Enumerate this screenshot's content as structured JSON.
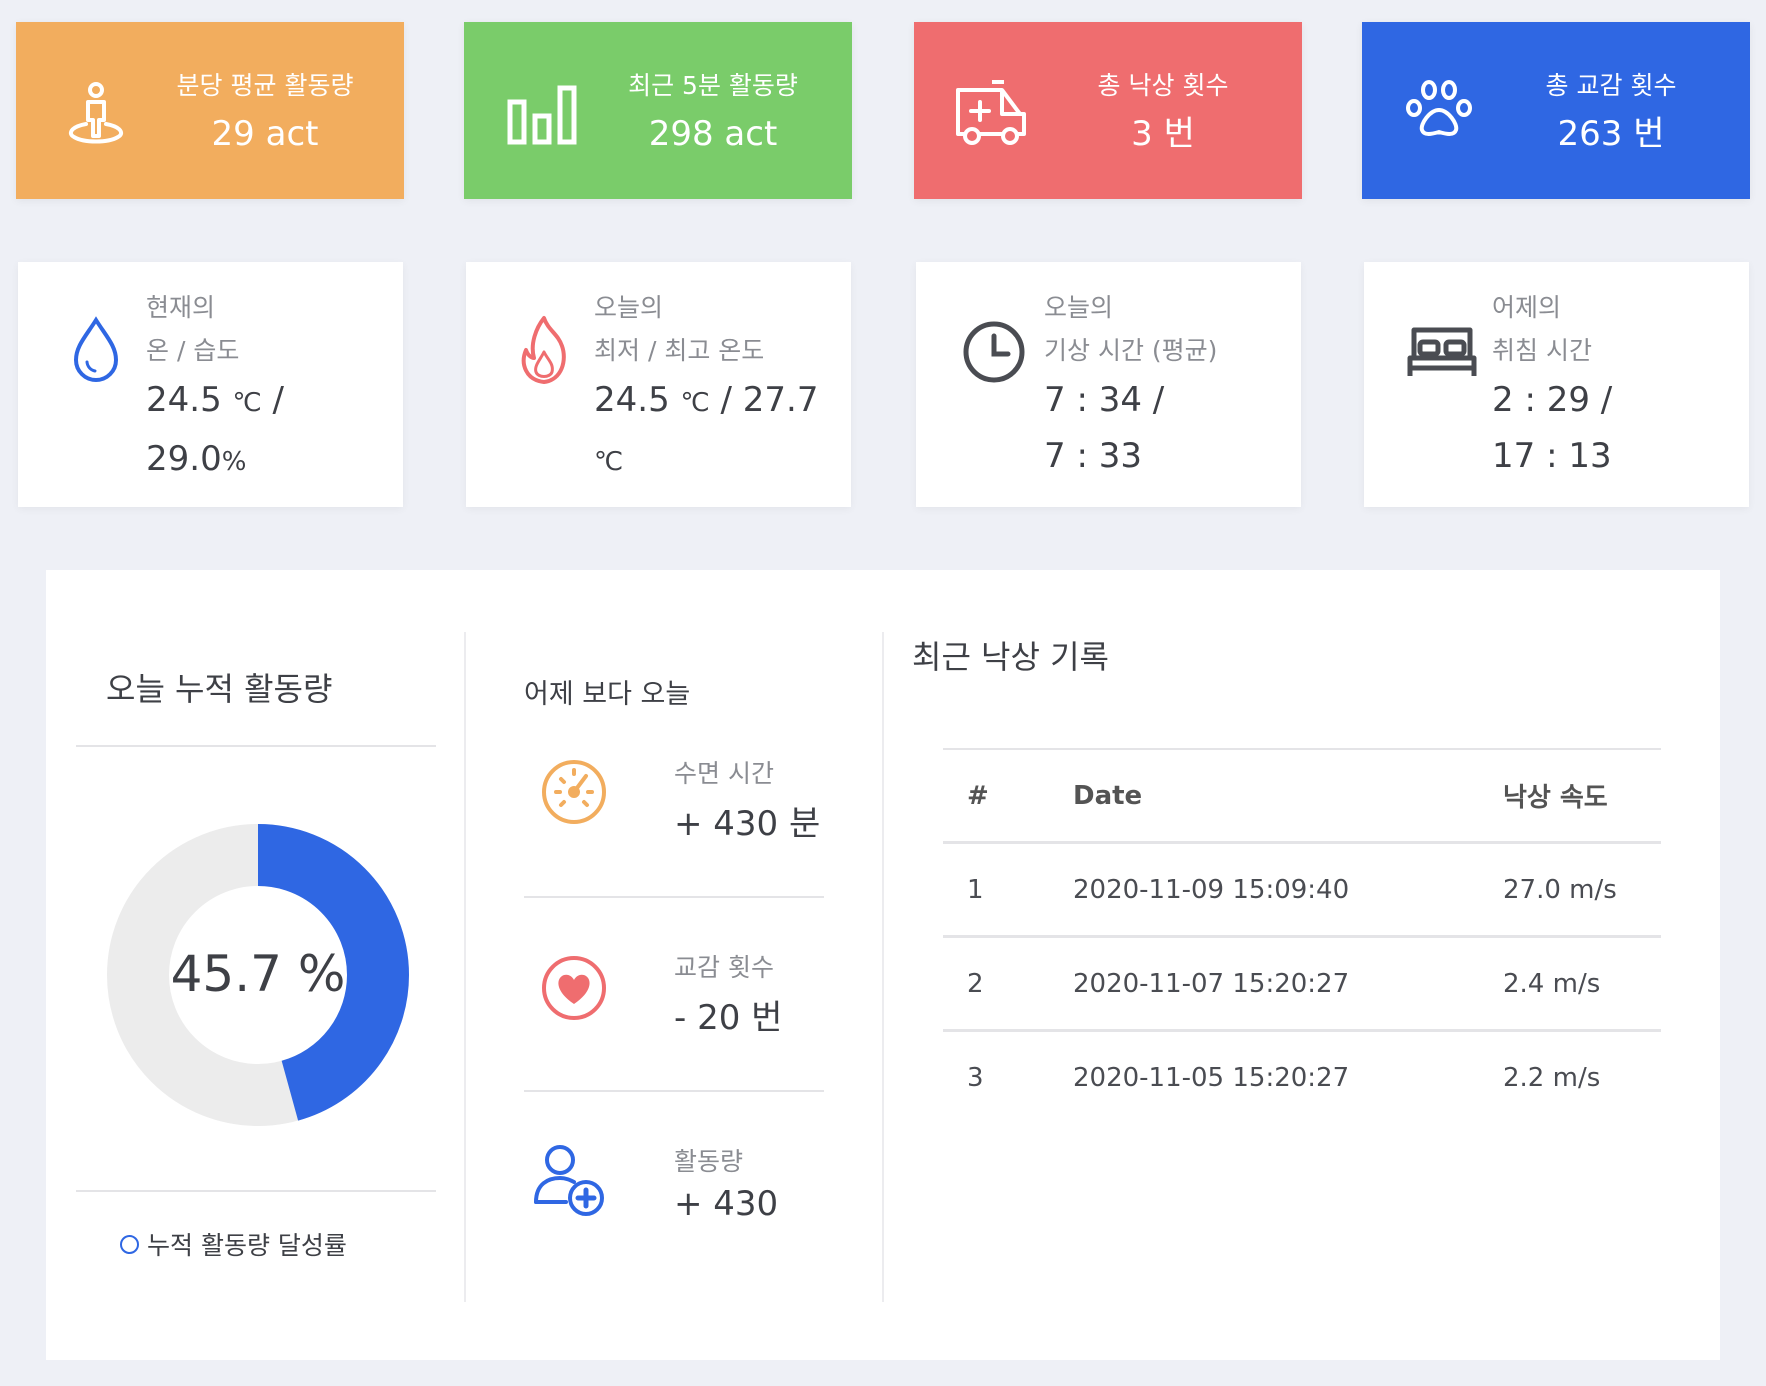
{
  "stat_cards": [
    {
      "label": "분당 평균 활동량",
      "value": "29 act",
      "color": "#f2ad5e",
      "icon": "person-pin-icon"
    },
    {
      "label": "최근 5분 활동량",
      "value": "298 act",
      "color": "#7acc6a",
      "icon": "bar-chart-icon"
    },
    {
      "label": "총 낙상 횟수",
      "value": "3 번",
      "color": "#ef6d6f",
      "icon": "ambulance-icon"
    },
    {
      "label": "총 교감 횟수",
      "value": "263 번",
      "color": "#2f67e3",
      "icon": "paw-icon"
    }
  ],
  "info_cards": [
    {
      "label1": "현재의",
      "label2": "온 / 습도",
      "value1": "24.5",
      "unit1": "℃",
      "sep": "/",
      "value2": "29.0",
      "unit2": "%",
      "icon": "water-drop-icon"
    },
    {
      "label1": "오늘의",
      "label2": "최저 / 최고 온도",
      "value1": "24.5",
      "unit1": "℃",
      "sep": "/ 27.7",
      "unit2": "℃",
      "icon": "flame-icon"
    },
    {
      "label1": "오늘의",
      "label2": "기상 시간 (평균)",
      "value1": "7 : 34 /",
      "value2": "7 : 33",
      "icon": "clock-icon"
    },
    {
      "label1": "어제의",
      "label2": "취침 시간",
      "value1": "2 : 29 /",
      "value2": "17 : 13",
      "icon": "bed-icon"
    }
  ],
  "activity": {
    "title": "오늘 누적 활동량",
    "percent_label": "45.7 %",
    "percent": 45.7,
    "legend": "누적 활동량 달성률",
    "fill_color": "#2f67e3",
    "track_color": "#ececec"
  },
  "compare": {
    "title": "어제 보다 오늘",
    "items": [
      {
        "label": "수면 시간",
        "value": "+ 430 분",
        "icon": "speedometer-icon"
      },
      {
        "label": "교감 횟수",
        "value": "- 20 번",
        "icon": "heart-icon"
      },
      {
        "label": "활동량",
        "value": "+ 430",
        "icon": "user-add-icon"
      }
    ]
  },
  "falls": {
    "title": "최근 낙상 기록",
    "columns": [
      "#",
      "Date",
      "낙상 속도"
    ],
    "rows": [
      [
        "1",
        "2020-11-09 15:09:40",
        "27.0 m/s"
      ],
      [
        "2",
        "2020-11-07 15:20:27",
        "2.4 m/s"
      ],
      [
        "3",
        "2020-11-05 15:20:27",
        "2.2 m/s"
      ]
    ]
  }
}
